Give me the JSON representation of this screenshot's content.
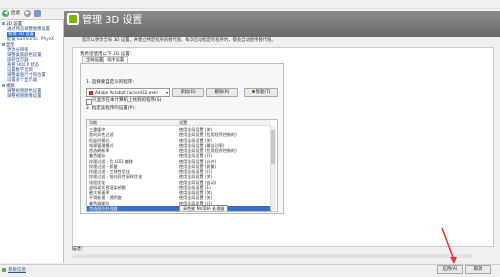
{
  "menu": [
    "文件(F)",
    "编辑(E)",
    "桌面(K)",
    "3D 设置(S)",
    "帮助(H)"
  ],
  "toolbar": {
    "back_label": "后退"
  },
  "tree": [
    {
      "label": "3D 设置",
      "head": true
    },
    {
      "label": "通过预览调整图像设置",
      "head": false
    },
    {
      "label": "管理 3D 设置",
      "head": false,
      "selected": true
    },
    {
      "label": "配置 Surround、PhysX",
      "head": false
    },
    {
      "label": "显示",
      "head": true
    },
    {
      "label": "更改分辨率",
      "head": false
    },
    {
      "label": "调整桌面颜色设置",
      "head": false
    },
    {
      "label": "旋转显示器",
      "head": false
    },
    {
      "label": "查看 HDCP 状态",
      "head": false
    },
    {
      "label": "设置数字音频",
      "head": false
    },
    {
      "label": "调整桌面尺寸和位置",
      "head": false
    },
    {
      "label": "设置多个显示器",
      "head": false
    },
    {
      "label": "视频",
      "head": true
    },
    {
      "label": "调整视频颜色设置",
      "head": false
    },
    {
      "label": "调整视频图像设置",
      "head": false
    }
  ],
  "header": {
    "title": "管理 3D 设置"
  },
  "description": "您可以更改全局 3D 设置，并建立特定程序的替代值。每次启动指定的程序时，都会自动使用替代值。",
  "section_label": "我希望使用以下 3D 设置：",
  "tabs": [
    "全局设置",
    "程序设置"
  ],
  "step1_label": "1. 选择要自定义的程序：",
  "app_value": "Adobe Acrobat (acrord32.exe)",
  "buttons": {
    "add": "添加(D)",
    "remove": "删除(R)",
    "restore": "恢复(T)"
  },
  "show_only_label": "只显示在本计算机上找到的程序(S)",
  "step2_label": "2. 指定该程序的设置(P)：",
  "table_headers": [
    "功能",
    "设置"
  ],
  "rows": [
    {
      "feature": "三重缓冲",
      "setting": "使用全局设置 (关)"
    },
    {
      "feature": "各向异性过滤",
      "setting": "使用全局设置 (应用程序控制的)"
    },
    {
      "feature": "低延时模式",
      "setting": "使用全局设置 (关)"
    },
    {
      "feature": "电源管理模式",
      "setting": "使用全局设置 (最佳功率)"
    },
    {
      "feature": "首选刷新率",
      "setting": "使用全局设置 (应用程序控制的)"
    },
    {
      "feature": "着色缓存",
      "setting": "使用全局设置 (开)"
    },
    {
      "feature": "纹理过滤 - 负 LOD 偏移",
      "setting": "使用全局设置 (允许)"
    },
    {
      "feature": "纹理过滤 - 质量",
      "setting": "使用全局设置 (质量)"
    },
    {
      "feature": "纹理过滤 - 三线性优化",
      "setting": "使用全局设置 (开)"
    },
    {
      "feature": "纹理过滤 - 各向异性采样优化",
      "setting": "使用全局设置 (关)"
    },
    {
      "feature": "线程优化",
      "setting": "使用全局设置 (自动)"
    },
    {
      "feature": "虚拟现实预渲染帧数",
      "setting": "使用全局设置 (1)"
    },
    {
      "feature": "最大帧速率",
      "setting": "使用全局设置 (关)"
    },
    {
      "feature": "平滑处理 - 透明度",
      "setting": "使用全局设置 (关)"
    },
    {
      "feature": "着色器缓存",
      "setting": "使用全局设置 (开)"
    },
    {
      "feature": "首选图形处理器",
      "setting": "高性能 NVIDIA 处理器",
      "selected": true
    }
  ],
  "footer": {
    "desc_label": "描述：",
    "apply": "应用(A)",
    "cancel": "取消",
    "system_info": "系统信息"
  }
}
